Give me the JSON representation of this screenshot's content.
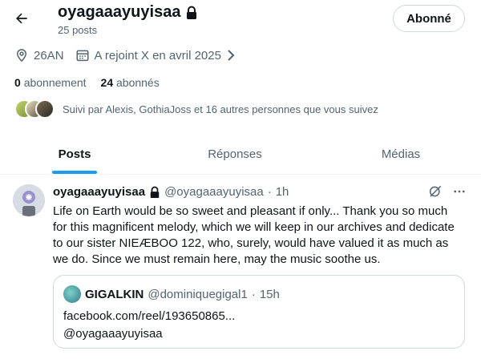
{
  "header": {
    "display_name": "oyagaaayuyisaa",
    "post_count": "25 posts",
    "follow_button": "Abonné"
  },
  "profile": {
    "location": "26AN",
    "joined": "A rejoint X en avril 2025",
    "following_count": "0",
    "following_label": "abonnement",
    "followers_count": "24",
    "followers_label": "abonnés",
    "followed_by": "Suivi par Alexis, GothiaJoss et 16 autres personnes que vous suivez"
  },
  "tabs": [
    {
      "label": "Posts",
      "active": true
    },
    {
      "label": "Réponses",
      "active": false
    },
    {
      "label": "Médias",
      "active": false
    }
  ],
  "post": {
    "name": "oyagaaayuyisaa",
    "handle": "@oyagaaayuyisaa",
    "separator": "·",
    "time": "1h",
    "text": "Life on Earth would be so sweet and pleasant if only... Thank you so much for this magnificent melody, which we will keep in our archives and dedicate to our sister NIEÆBOO 122, who, surely, would have valued it as much as we do. Since we must remain here, may the music soothe us.",
    "quote": {
      "name": "GIGALKIN",
      "handle": "@dominiquegigal1",
      "separator": "·",
      "time": "15h",
      "link": "facebook.com/reel/193650865...",
      "mention": "@oyagaaayuyisaa"
    }
  },
  "colors": {
    "accent": "#1d9bf0",
    "text_primary": "#0f1419",
    "text_secondary": "#536471",
    "border": "#cfd9de"
  },
  "icons": [
    "back-arrow-icon",
    "lock-icon",
    "location-pin-icon",
    "calendar-icon",
    "chevron-right-icon",
    "grok-icon",
    "more-icon"
  ]
}
